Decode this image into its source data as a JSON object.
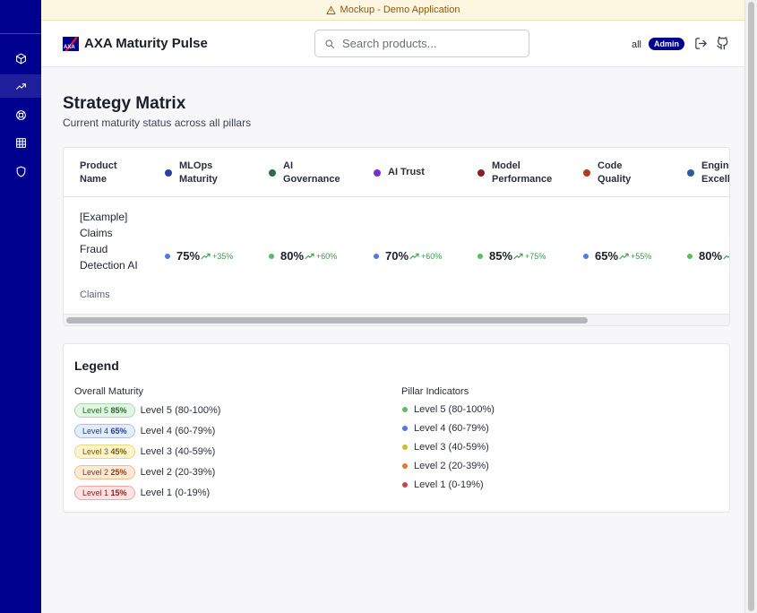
{
  "banner": {
    "text": "Mockup - Demo Application",
    "icon": "warning-icon"
  },
  "header": {
    "app_title": "AXA Maturity Pulse",
    "logo_text": "AXA",
    "search_placeholder": "Search products...",
    "user": "all",
    "role": "Admin",
    "icons": [
      "logout-icon",
      "github-icon"
    ]
  },
  "sidebar": {
    "items": [
      {
        "icon": "cube-icon",
        "active": false
      },
      {
        "icon": "trending-up-icon",
        "active": true
      },
      {
        "icon": "lifebuoy-icon",
        "active": false
      },
      {
        "icon": "grid-icon",
        "active": false
      },
      {
        "icon": "shield-icon",
        "active": false
      }
    ]
  },
  "page": {
    "title": "Strategy Matrix",
    "subtitle": "Current maturity status across all pillars"
  },
  "matrix": {
    "product_header": "Product Name",
    "pillars": [
      {
        "name": "MLOps Maturity",
        "color": "#2a3fa8"
      },
      {
        "name": "AI Governance",
        "color": "#2f6b3e"
      },
      {
        "name": "AI Trust",
        "color": "#7b2fd0"
      },
      {
        "name": "Model Performance",
        "color": "#8a1f1f"
      },
      {
        "name": "Code Quality",
        "color": "#b03a1f"
      },
      {
        "name": "Engineering Excellence",
        "color": "#2d5a9e"
      }
    ],
    "rows": [
      {
        "product": "[Example] Claims Fraud Detection AI",
        "department": "Claims",
        "cells": [
          {
            "value": "75%",
            "trend": "+35%",
            "dot_color": "#4f7be0"
          },
          {
            "value": "80%",
            "trend": "+60%",
            "dot_color": "#5cbc5f"
          },
          {
            "value": "70%",
            "trend": "+60%",
            "dot_color": "#4f7be0"
          },
          {
            "value": "85%",
            "trend": "+75%",
            "dot_color": "#5cbc5f"
          },
          {
            "value": "65%",
            "trend": "+55%",
            "dot_color": "#4f7be0"
          },
          {
            "value": "80%",
            "trend": "",
            "dot_color": "#5cbc5f"
          }
        ]
      }
    ]
  },
  "legend": {
    "title": "Legend",
    "overall_title": "Overall Maturity",
    "pillar_title": "Pillar Indicators",
    "overall": [
      {
        "badge_level": "Level 5",
        "badge_pct": "85%",
        "desc": "Level 5 (80-100%)",
        "bg": "#e3f6e5",
        "border": "#a9dcae",
        "fg": "#1e6b2a"
      },
      {
        "badge_level": "Level 4",
        "badge_pct": "65%",
        "desc": "Level 4 (60-79%)",
        "bg": "#e2ecfb",
        "border": "#a9c1ee",
        "fg": "#1f3f8f"
      },
      {
        "badge_level": "Level 3",
        "badge_pct": "45%",
        "desc": "Level 3 (40-59%)",
        "bg": "#fcf5cf",
        "border": "#ecd97b",
        "fg": "#7a5a05"
      },
      {
        "badge_level": "Level 2",
        "badge_pct": "25%",
        "desc": "Level 2 (20-39%)",
        "bg": "#fde9d6",
        "border": "#f1bd8c",
        "fg": "#8a3f0c"
      },
      {
        "badge_level": "Level 1",
        "badge_pct": "15%",
        "desc": "Level 1 (0-19%)",
        "bg": "#fde2e2",
        "border": "#f1a7a7",
        "fg": "#8f1f1f"
      }
    ],
    "pillar_indicators": [
      {
        "desc": "Level 5 (80-100%)",
        "color": "#5cbc5f"
      },
      {
        "desc": "Level 4 (60-79%)",
        "color": "#4f7be0"
      },
      {
        "desc": "Level 3 (40-59%)",
        "color": "#d8b923"
      },
      {
        "desc": "Level 2 (20-39%)",
        "color": "#e07a2c"
      },
      {
        "desc": "Level 1 (0-19%)",
        "color": "#c94444"
      }
    ]
  }
}
